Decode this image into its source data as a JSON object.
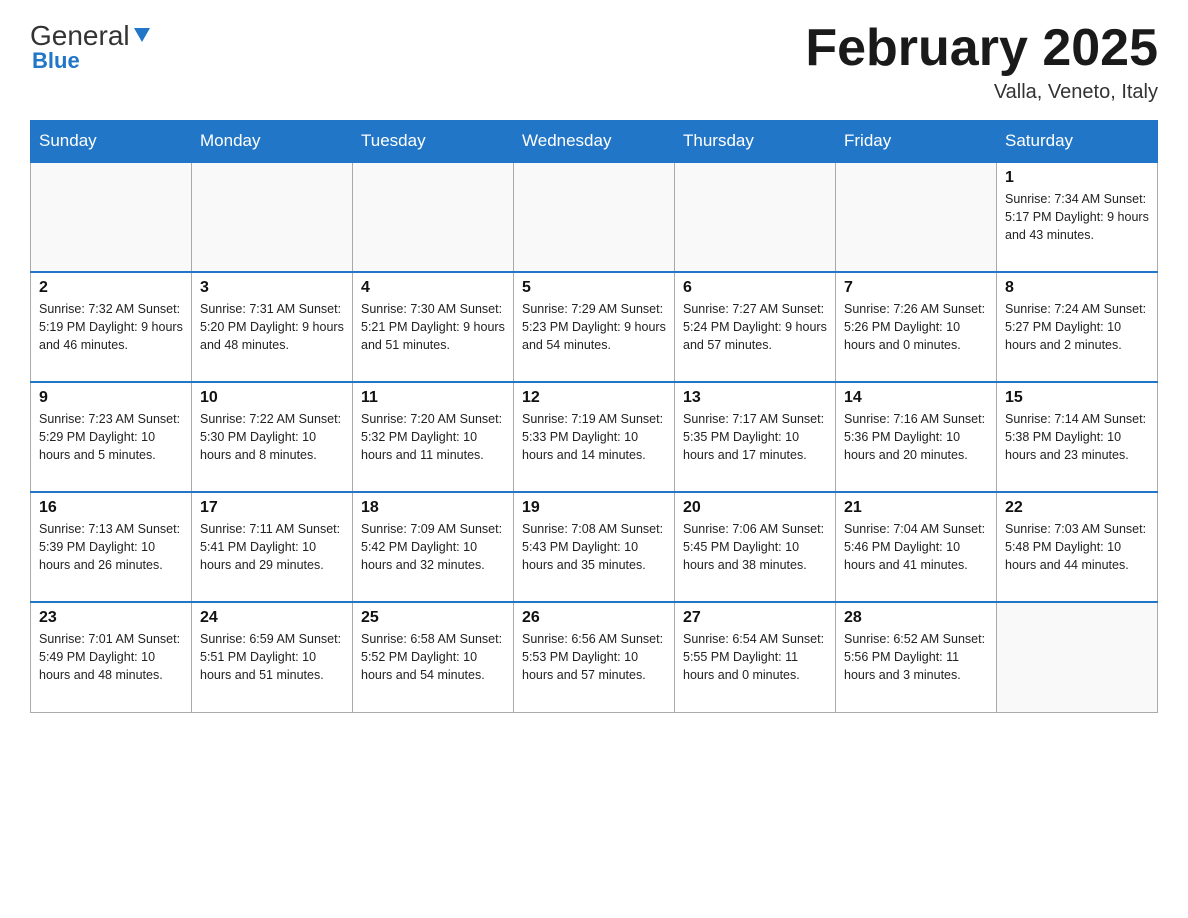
{
  "header": {
    "logo_general": "General",
    "logo_blue": "Blue",
    "month_title": "February 2025",
    "location": "Valla, Veneto, Italy"
  },
  "days_of_week": [
    "Sunday",
    "Monday",
    "Tuesday",
    "Wednesday",
    "Thursday",
    "Friday",
    "Saturday"
  ],
  "weeks": [
    [
      {
        "day": "",
        "info": ""
      },
      {
        "day": "",
        "info": ""
      },
      {
        "day": "",
        "info": ""
      },
      {
        "day": "",
        "info": ""
      },
      {
        "day": "",
        "info": ""
      },
      {
        "day": "",
        "info": ""
      },
      {
        "day": "1",
        "info": "Sunrise: 7:34 AM\nSunset: 5:17 PM\nDaylight: 9 hours and 43 minutes."
      }
    ],
    [
      {
        "day": "2",
        "info": "Sunrise: 7:32 AM\nSunset: 5:19 PM\nDaylight: 9 hours and 46 minutes."
      },
      {
        "day": "3",
        "info": "Sunrise: 7:31 AM\nSunset: 5:20 PM\nDaylight: 9 hours and 48 minutes."
      },
      {
        "day": "4",
        "info": "Sunrise: 7:30 AM\nSunset: 5:21 PM\nDaylight: 9 hours and 51 minutes."
      },
      {
        "day": "5",
        "info": "Sunrise: 7:29 AM\nSunset: 5:23 PM\nDaylight: 9 hours and 54 minutes."
      },
      {
        "day": "6",
        "info": "Sunrise: 7:27 AM\nSunset: 5:24 PM\nDaylight: 9 hours and 57 minutes."
      },
      {
        "day": "7",
        "info": "Sunrise: 7:26 AM\nSunset: 5:26 PM\nDaylight: 10 hours and 0 minutes."
      },
      {
        "day": "8",
        "info": "Sunrise: 7:24 AM\nSunset: 5:27 PM\nDaylight: 10 hours and 2 minutes."
      }
    ],
    [
      {
        "day": "9",
        "info": "Sunrise: 7:23 AM\nSunset: 5:29 PM\nDaylight: 10 hours and 5 minutes."
      },
      {
        "day": "10",
        "info": "Sunrise: 7:22 AM\nSunset: 5:30 PM\nDaylight: 10 hours and 8 minutes."
      },
      {
        "day": "11",
        "info": "Sunrise: 7:20 AM\nSunset: 5:32 PM\nDaylight: 10 hours and 11 minutes."
      },
      {
        "day": "12",
        "info": "Sunrise: 7:19 AM\nSunset: 5:33 PM\nDaylight: 10 hours and 14 minutes."
      },
      {
        "day": "13",
        "info": "Sunrise: 7:17 AM\nSunset: 5:35 PM\nDaylight: 10 hours and 17 minutes."
      },
      {
        "day": "14",
        "info": "Sunrise: 7:16 AM\nSunset: 5:36 PM\nDaylight: 10 hours and 20 minutes."
      },
      {
        "day": "15",
        "info": "Sunrise: 7:14 AM\nSunset: 5:38 PM\nDaylight: 10 hours and 23 minutes."
      }
    ],
    [
      {
        "day": "16",
        "info": "Sunrise: 7:13 AM\nSunset: 5:39 PM\nDaylight: 10 hours and 26 minutes."
      },
      {
        "day": "17",
        "info": "Sunrise: 7:11 AM\nSunset: 5:41 PM\nDaylight: 10 hours and 29 minutes."
      },
      {
        "day": "18",
        "info": "Sunrise: 7:09 AM\nSunset: 5:42 PM\nDaylight: 10 hours and 32 minutes."
      },
      {
        "day": "19",
        "info": "Sunrise: 7:08 AM\nSunset: 5:43 PM\nDaylight: 10 hours and 35 minutes."
      },
      {
        "day": "20",
        "info": "Sunrise: 7:06 AM\nSunset: 5:45 PM\nDaylight: 10 hours and 38 minutes."
      },
      {
        "day": "21",
        "info": "Sunrise: 7:04 AM\nSunset: 5:46 PM\nDaylight: 10 hours and 41 minutes."
      },
      {
        "day": "22",
        "info": "Sunrise: 7:03 AM\nSunset: 5:48 PM\nDaylight: 10 hours and 44 minutes."
      }
    ],
    [
      {
        "day": "23",
        "info": "Sunrise: 7:01 AM\nSunset: 5:49 PM\nDaylight: 10 hours and 48 minutes."
      },
      {
        "day": "24",
        "info": "Sunrise: 6:59 AM\nSunset: 5:51 PM\nDaylight: 10 hours and 51 minutes."
      },
      {
        "day": "25",
        "info": "Sunrise: 6:58 AM\nSunset: 5:52 PM\nDaylight: 10 hours and 54 minutes."
      },
      {
        "day": "26",
        "info": "Sunrise: 6:56 AM\nSunset: 5:53 PM\nDaylight: 10 hours and 57 minutes."
      },
      {
        "day": "27",
        "info": "Sunrise: 6:54 AM\nSunset: 5:55 PM\nDaylight: 11 hours and 0 minutes."
      },
      {
        "day": "28",
        "info": "Sunrise: 6:52 AM\nSunset: 5:56 PM\nDaylight: 11 hours and 3 minutes."
      },
      {
        "day": "",
        "info": ""
      }
    ]
  ]
}
